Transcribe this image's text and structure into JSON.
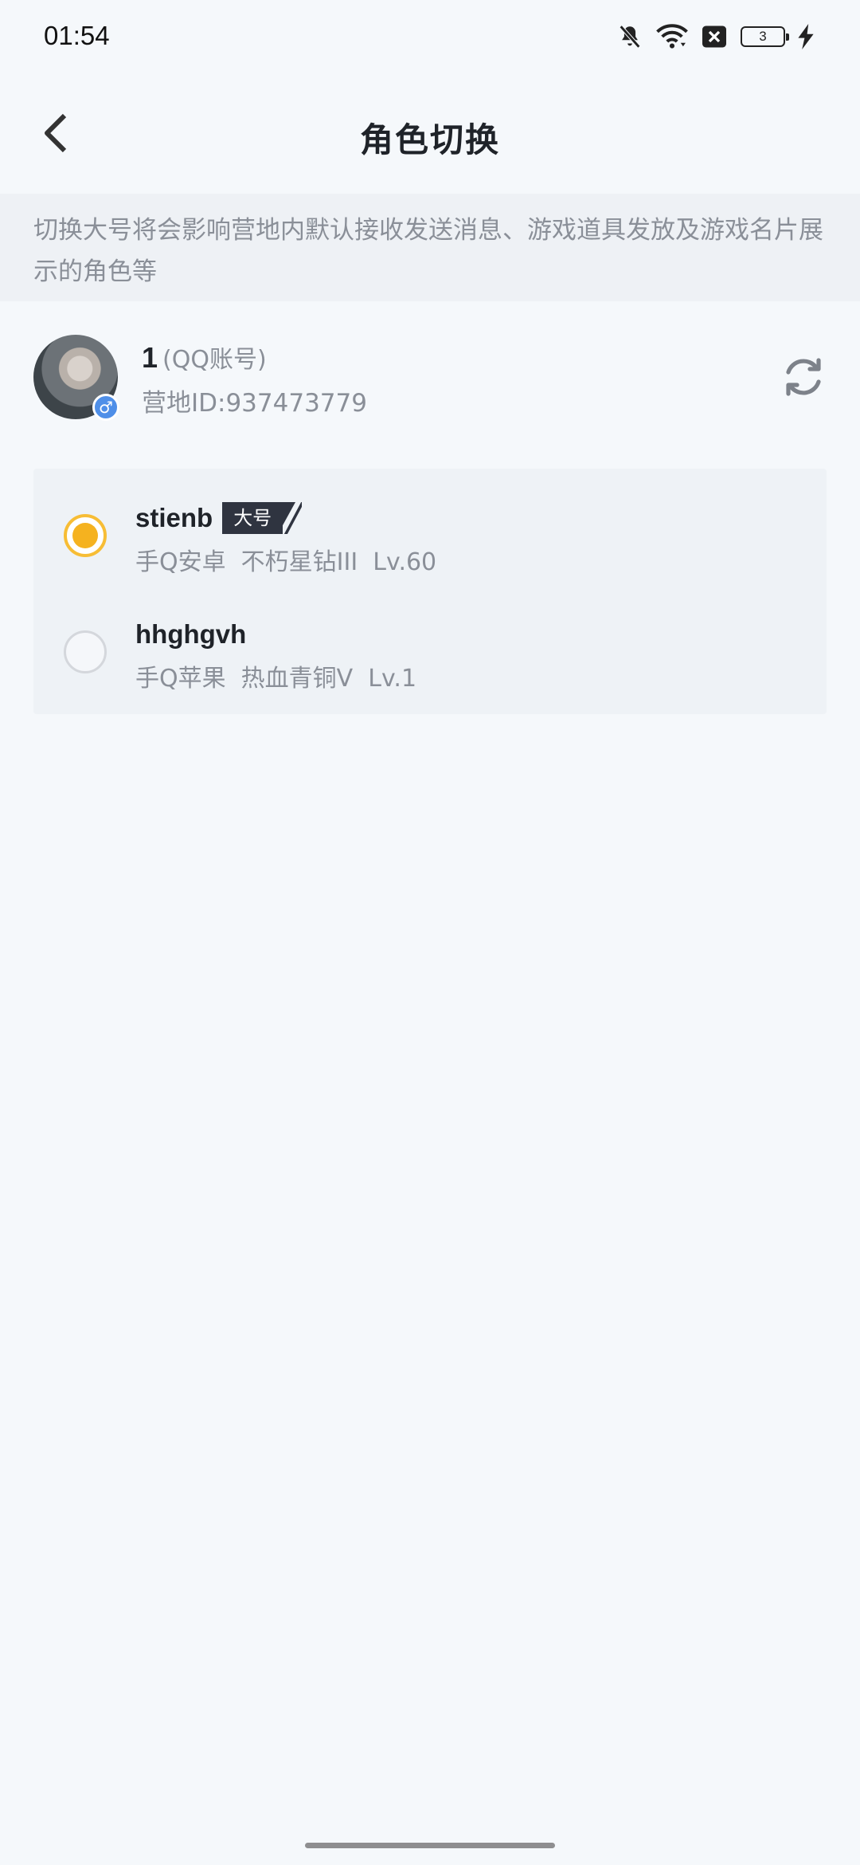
{
  "status_bar": {
    "time": "01:54",
    "battery_level": "3",
    "icons": [
      "bell-muted-icon",
      "wifi-icon",
      "sim-error-icon",
      "battery-icon",
      "charging-icon"
    ]
  },
  "header": {
    "title": "角色切换",
    "back_icon": "chevron-left-icon"
  },
  "notice": {
    "text": "切换大号将会影响营地内默认接收发送消息、游戏道具发放及游戏名片展示的角色等"
  },
  "account": {
    "name": "1",
    "type": "(QQ账号)",
    "id_label": "营地ID:937473779",
    "gender_symbol": "♂",
    "refresh_icon": "refresh-icon"
  },
  "roles": [
    {
      "name": "stienb",
      "badge": "大号",
      "detail": "手Q安卓  不朽星钻III  Lv.60",
      "selected": true
    },
    {
      "name": "hhghgvh",
      "badge": "",
      "detail": "手Q苹果  热血青铜V  Lv.1",
      "selected": false
    }
  ],
  "colors": {
    "accent": "#f5b21f",
    "badge_bg": "#2f3440",
    "background": "#f5f8fb",
    "secondary_text": "#8a8f98"
  }
}
